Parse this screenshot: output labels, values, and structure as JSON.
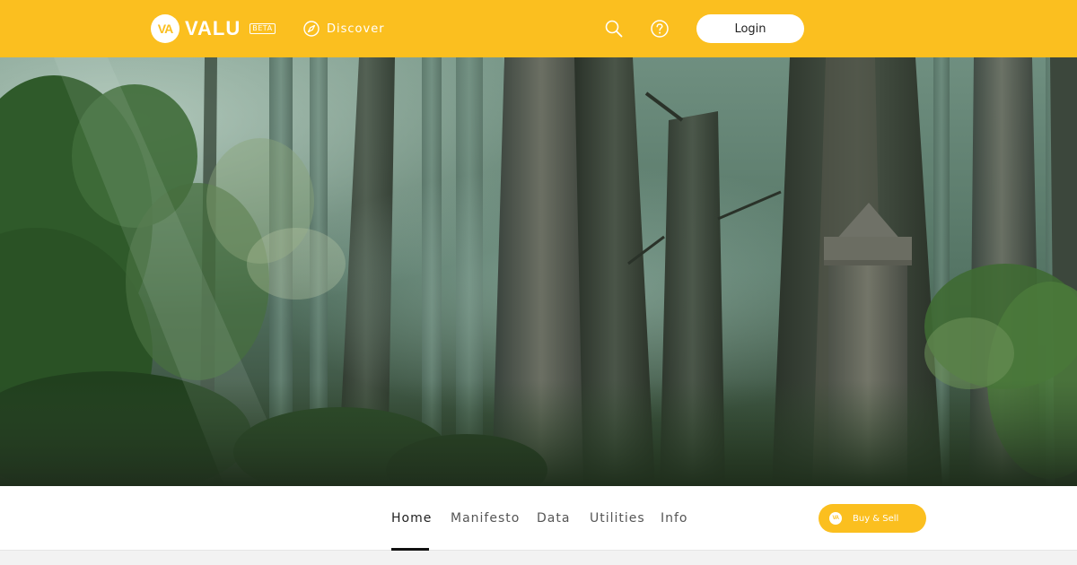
{
  "header": {
    "logo_mark": "VA",
    "logo_text": "VALU",
    "beta_badge": "BETA",
    "discover_label": "Discover",
    "login_label": "Login",
    "search_icon": "search-icon",
    "help_icon": "help-circle-icon",
    "compass_icon": "compass-icon"
  },
  "tabs": [
    {
      "label": "Home",
      "active": true
    },
    {
      "label": "Manifesto",
      "active": false
    },
    {
      "label": "Data",
      "active": false
    },
    {
      "label": "Utilities",
      "active": false
    },
    {
      "label": "Info",
      "active": false
    }
  ],
  "buy_sell": {
    "mark": "VA",
    "label": "Buy & Sell"
  },
  "colors": {
    "brand_yellow": "#fbbf1f",
    "white": "#ffffff",
    "tab_active": "#222222",
    "tab_inactive": "#555555",
    "page_background": "#f2f2f2"
  }
}
